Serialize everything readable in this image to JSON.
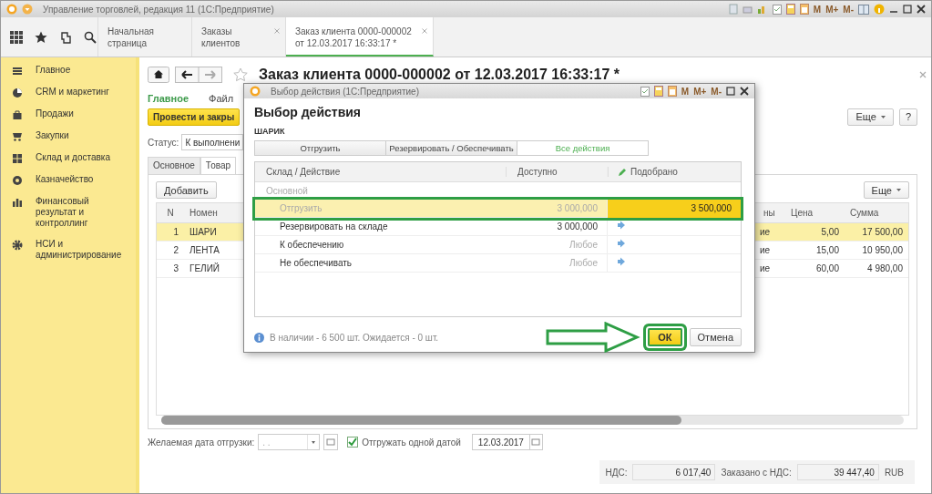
{
  "window": {
    "title": "Управление торговлей, редакция 11 (1С:Предприятие)",
    "tools": [
      "M",
      "M+",
      "M-"
    ]
  },
  "nav_tabs": [
    {
      "label": "Начальная страница",
      "selected": false,
      "closable": false
    },
    {
      "label": "Заказы клиентов",
      "selected": false,
      "closable": true
    },
    {
      "label": "Заказ клиента 0000-000002 от 12.03.2017 16:33:17 *",
      "selected": true,
      "closable": true
    }
  ],
  "sidebar": {
    "items": [
      {
        "label": "Главное",
        "kind": "menu"
      },
      {
        "label": "CRM и маркетинг",
        "kind": "crm"
      },
      {
        "label": "Продажи",
        "kind": "bag"
      },
      {
        "label": "Закупки",
        "kind": "cart"
      },
      {
        "label": "Склад и доставка",
        "kind": "grid"
      },
      {
        "label": "Казначейство",
        "kind": "coin"
      },
      {
        "label": "Финансовый результат и контроллинг",
        "kind": "bars"
      },
      {
        "label": "НСИ и администрирование",
        "kind": "gear"
      }
    ]
  },
  "document": {
    "title": "Заказ клиента 0000-000002 от 12.03.2017 16:33:17 *",
    "links": [
      {
        "label": "Главное",
        "selected": true
      },
      {
        "label": "Файл",
        "selected": false
      }
    ],
    "post_button": "Провести и закры",
    "more_button": "Еще",
    "help_button": "?",
    "status_label": "Статус:",
    "status_value": "К выполнени",
    "tabs": [
      {
        "label": "Основное",
        "selected": false
      },
      {
        "label": "Товар",
        "selected": true
      }
    ],
    "add_button": "Добавить",
    "table_more_button": "Еще",
    "table": {
      "columns": [
        "N",
        "Номен",
        "ны",
        "Цена",
        "Сумма"
      ],
      "rows": [
        {
          "cells": [
            "1",
            "ШАРИ",
            "ие",
            "5,00",
            "17 500,00"
          ],
          "selected": true
        },
        {
          "cells": [
            "2",
            "ЛЕНТА",
            "ие",
            "15,00",
            "10 950,00"
          ],
          "selected": false
        },
        {
          "cells": [
            "3",
            "ГЕЛИЙ",
            "ие",
            "60,00",
            "4 980,00"
          ],
          "selected": false
        }
      ]
    },
    "ship_date": {
      "label": "Желаемая дата отгрузки:",
      "placeholder": ". ."
    },
    "single_date": {
      "label": "Отгружать одной датой",
      "checked": true,
      "value": "12.03.2017"
    },
    "totals": [
      {
        "label": "НДС:",
        "value": "6 017,40"
      },
      {
        "label": "Заказано с НДС:",
        "value": "39 447,40"
      }
    ],
    "currency": "RUB"
  },
  "dialog": {
    "title": "Выбор действия (1С:Предприятие)",
    "tools": [
      "M",
      "M+",
      "M-"
    ],
    "heading": "Выбор действия",
    "item": "ШАРИК",
    "filters": [
      {
        "label": "Отгрузить",
        "selected": false
      },
      {
        "label": "Резервировать / Обеспечивать",
        "selected": false
      },
      {
        "label": "Все действия",
        "selected": true
      }
    ],
    "columns": [
      "Склад / Действие",
      "Доступно",
      "Подобрано"
    ],
    "group": "Основной",
    "rows": [
      {
        "kind": "picked",
        "action": "Отгрузить",
        "available": "3 000,000",
        "available_dim": true,
        "picked": "3 500,000",
        "selected": true,
        "disabled": true,
        "highlighted": true
      },
      {
        "kind": "transfer",
        "action": "Резервировать на складе",
        "available": "3 000,000",
        "available_dim": false,
        "selected": false,
        "disabled": false,
        "highlighted": false
      },
      {
        "kind": "transfer",
        "action": "К обеспечению",
        "available": "Любое",
        "available_dim": true,
        "selected": false,
        "disabled": false,
        "highlighted": false
      },
      {
        "kind": "transfer",
        "action": "Не обеспечивать",
        "available": "Любое",
        "available_dim": true,
        "selected": false,
        "disabled": false,
        "highlighted": false
      }
    ],
    "info": "В наличии - 6 500 шт. Ожидается - 0 шт.",
    "ok_button": {
      "label": "ОК",
      "highlighted": true
    },
    "cancel_button": "Отмена"
  }
}
